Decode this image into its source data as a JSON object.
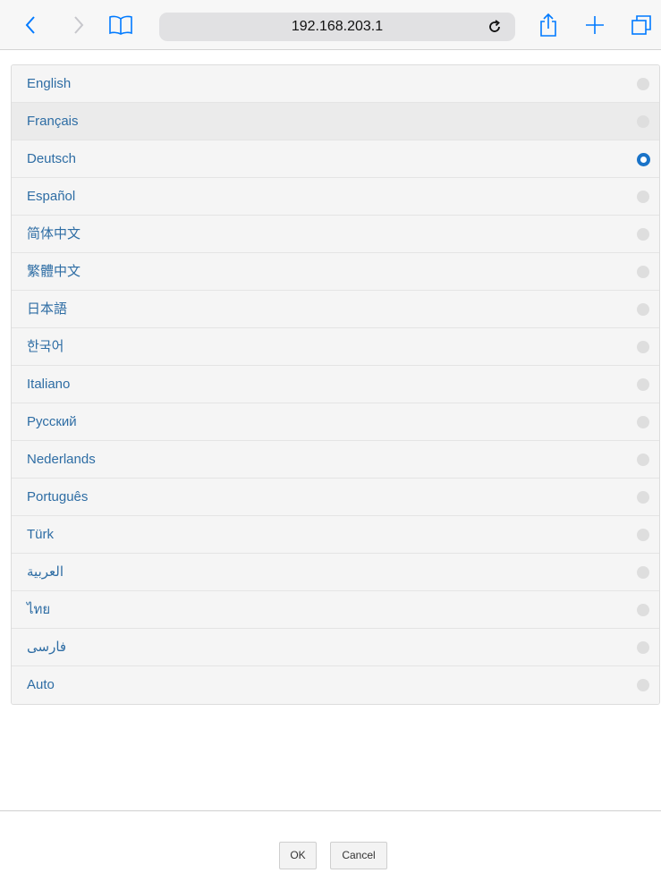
{
  "browser": {
    "url": "192.168.203.1",
    "icons": [
      "back-icon",
      "forward-icon",
      "bookmarks-icon",
      "reload-icon",
      "share-icon",
      "new-tab-icon",
      "tabs-icon"
    ]
  },
  "languages": {
    "selected": "Deutsch",
    "items": [
      {
        "label": "English"
      },
      {
        "label": "Français"
      },
      {
        "label": "Deutsch"
      },
      {
        "label": "Español"
      },
      {
        "label": "简体中文"
      },
      {
        "label": "繁體中文"
      },
      {
        "label": "日本語"
      },
      {
        "label": "한국어"
      },
      {
        "label": "Italiano"
      },
      {
        "label": "Русский"
      },
      {
        "label": "Nederlands"
      },
      {
        "label": "Português"
      },
      {
        "label": "Türk"
      },
      {
        "label": "العربية"
      },
      {
        "label": "ไทย"
      },
      {
        "label": "فارسی"
      },
      {
        "label": "Auto"
      }
    ]
  },
  "footer": {
    "ok_label": "OK",
    "cancel_label": "Cancel"
  },
  "colors": {
    "link": "#2e6da4",
    "accent": "#1a73c8",
    "ios_blue": "#007aff"
  }
}
